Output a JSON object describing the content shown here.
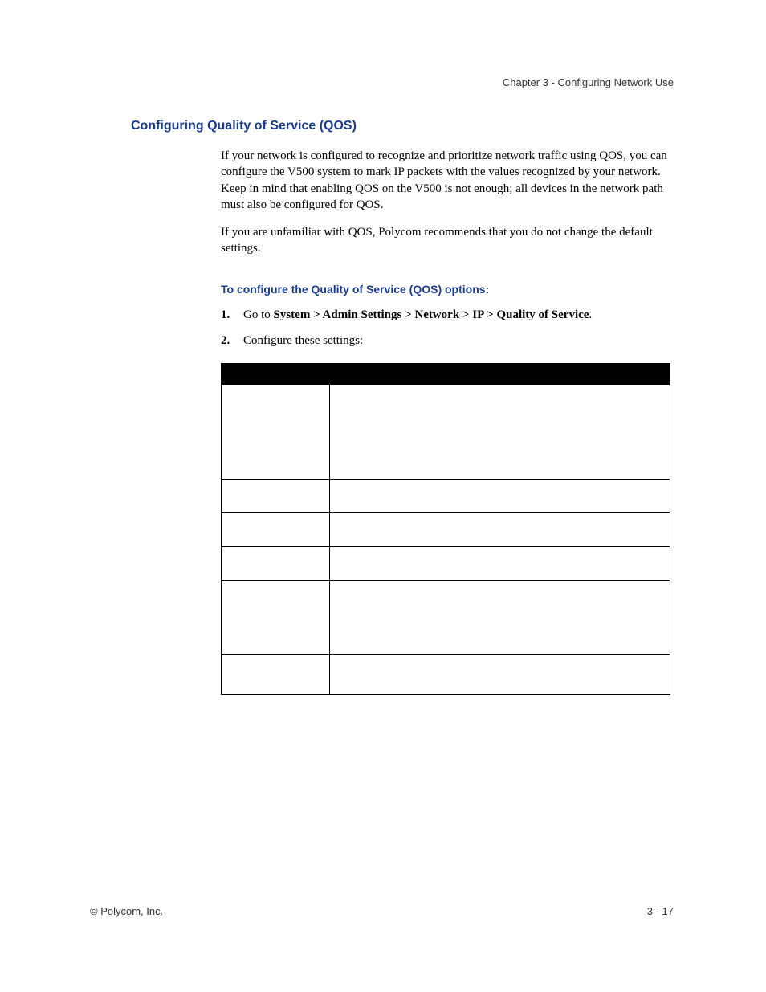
{
  "header": {
    "chapter_label": "Chapter 3 - Configuring Network Use"
  },
  "section": {
    "heading": "Configuring Quality of Service (QOS)",
    "para1": "If your network is configured to recognize and prioritize network traffic using QOS, you can configure the V500 system to mark IP packets with the values recognized by your network. Keep in mind that enabling QOS on the V500 is not enough; all devices in the network path must also be configured for QOS.",
    "para2": "If you are unfamiliar with QOS, Polycom recommends that you do not change the default settings.",
    "sub_heading": "To configure the Quality of Service (QOS) options:",
    "steps": {
      "step1_prefix": "Go to ",
      "step1_path": "System > Admin Settings > Network > IP > Quality of Service",
      "step1_suffix": ".",
      "step2": "Configure these settings:"
    }
  },
  "footer": {
    "left": "© Polycom, Inc.",
    "right": "3 - 17"
  }
}
